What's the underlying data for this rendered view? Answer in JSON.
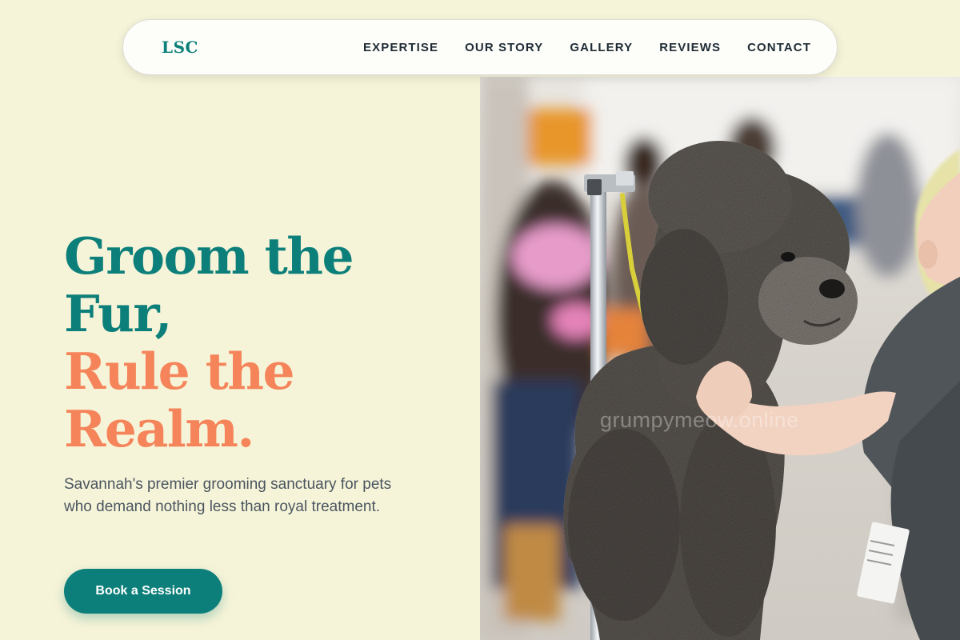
{
  "brand": {
    "logo_text": "LSC"
  },
  "nav": {
    "items": [
      {
        "label": "EXPERTISE"
      },
      {
        "label": "OUR STORY"
      },
      {
        "label": "GALLERY"
      },
      {
        "label": "REVIEWS"
      },
      {
        "label": "CONTACT"
      }
    ]
  },
  "hero": {
    "headline_line1": "Groom the",
    "headline_line2": "Fur,",
    "headline_line3": "Rule the",
    "headline_line4": "Realm.",
    "subtext": "Savannah's premier grooming sanctuary for pets who demand nothing less than royal treatment.",
    "cta_label": "Book a Session",
    "image_watermark": "grumpymeow.online"
  },
  "colors": {
    "background": "#f6f4d8",
    "accent_teal": "#0d7f7a",
    "accent_coral": "#f5845a",
    "nav_text": "#1e2b35",
    "body_text": "#4a5560"
  },
  "icons": {
    "hero_image": "poodle-grooming-photo"
  }
}
